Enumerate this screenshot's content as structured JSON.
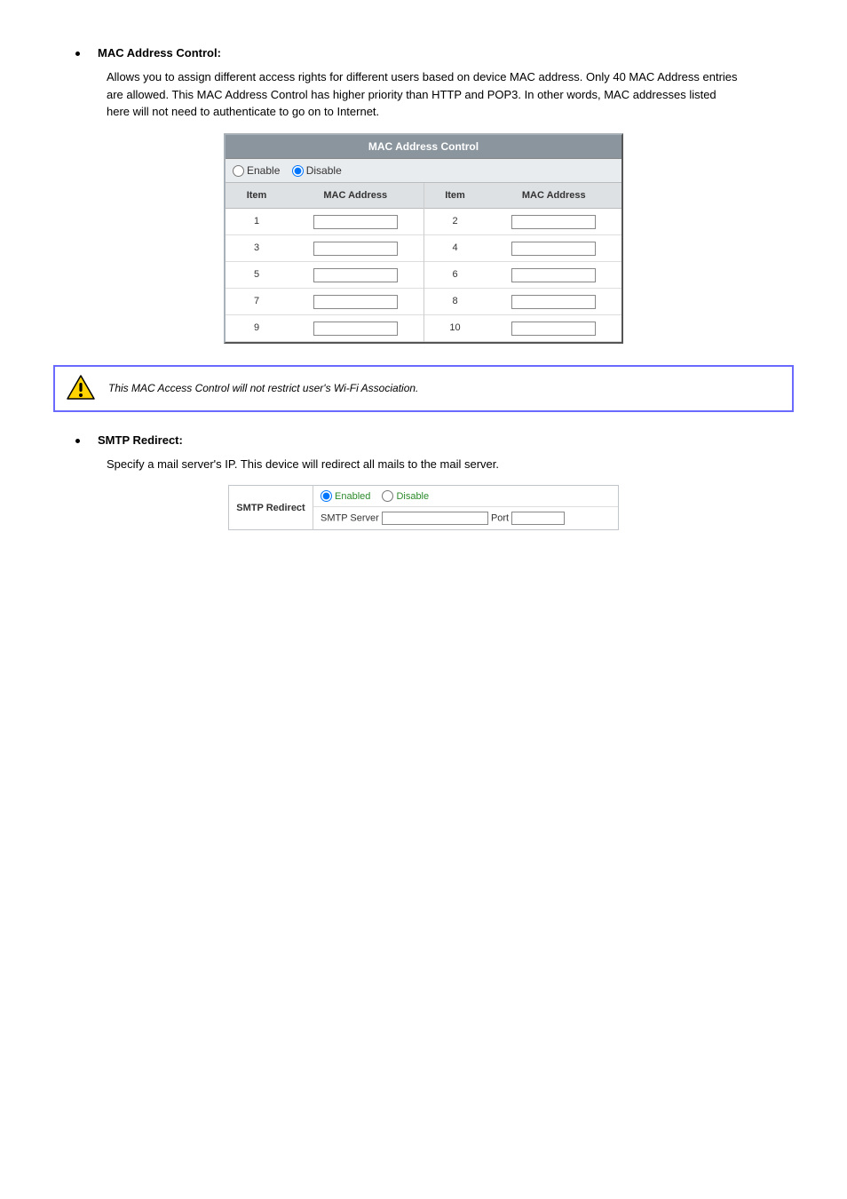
{
  "sections": {
    "mac": {
      "label": "MAC Address Control:",
      "desc": "Allows you to assign different access rights for different users based on device MAC address. Only 40 MAC Address entries are allowed. This MAC Address Control has higher priority than HTTP and POP3. In other words, MAC addresses listed here will not need to authenticate to go on to Internet."
    },
    "smtp": {
      "label": "SMTP Redirect:",
      "desc": "Specify a mail server's IP. This device will redirect all mails to the mail server."
    }
  },
  "macPanel": {
    "title": "MAC Address Control",
    "enableLabel": "Enable",
    "disableLabel": "Disable",
    "col_item": "Item",
    "col_mac": "MAC Address",
    "left": [
      "1",
      "3",
      "5",
      "7",
      "9"
    ],
    "right": [
      "2",
      "4",
      "6",
      "8",
      "10"
    ]
  },
  "warning": {
    "text": "This MAC Access Control will not restrict user's Wi-Fi Association."
  },
  "smtpPanel": {
    "rowLabel": "SMTP Redirect",
    "enabledLabel": "Enabled",
    "disableLabel": "Disable",
    "serverLabel": "SMTP Server",
    "portLabel": "Port"
  }
}
